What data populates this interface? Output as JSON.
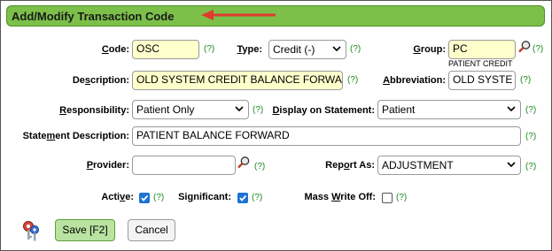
{
  "title": "Add/Modify Transaction Code",
  "help_text": "(?)",
  "fields": {
    "code": {
      "label": "Code:",
      "value": "OSC"
    },
    "type": {
      "label": "Type:",
      "value": "Credit (-)"
    },
    "group": {
      "label": "Group:",
      "value": "PC",
      "hint": "PATIENT CREDIT"
    },
    "description": {
      "label": "Description:",
      "value": "OLD SYSTEM CREDIT BALANCE FORWA"
    },
    "abbreviation": {
      "label": "Abbreviation:",
      "value": "OLD SYSTE"
    },
    "responsibility": {
      "label": "Responsibility:",
      "value": "Patient Only"
    },
    "display_on_statement": {
      "label": "Display on Statement:",
      "value": "Patient"
    },
    "statement_description": {
      "label": "Statement Description:",
      "value": "PATIENT BALANCE FORWARD"
    },
    "provider": {
      "label": "Provider:",
      "value": ""
    },
    "report_as": {
      "label": "Report As:",
      "value": "ADJUSTMENT"
    },
    "active": {
      "label": "Active:",
      "checked": true
    },
    "significant": {
      "label": "Significant:",
      "checked": true
    },
    "mass_write_off": {
      "label": "Mass Write Off:",
      "checked": false
    }
  },
  "buttons": {
    "save": "Save [F2]",
    "cancel": "Cancel"
  },
  "colors": {
    "title_bar": "#7cc04a",
    "required_field": "#ffffcc",
    "help": "#1a8a1a",
    "arrow": "#e03a2f",
    "checkbox_checked": "#1e73d2",
    "save_button": "#b9e3a0"
  },
  "icons": [
    "arrow-left-icon",
    "magnifier-icon",
    "keys-icon",
    "chevron-down-icon"
  ]
}
